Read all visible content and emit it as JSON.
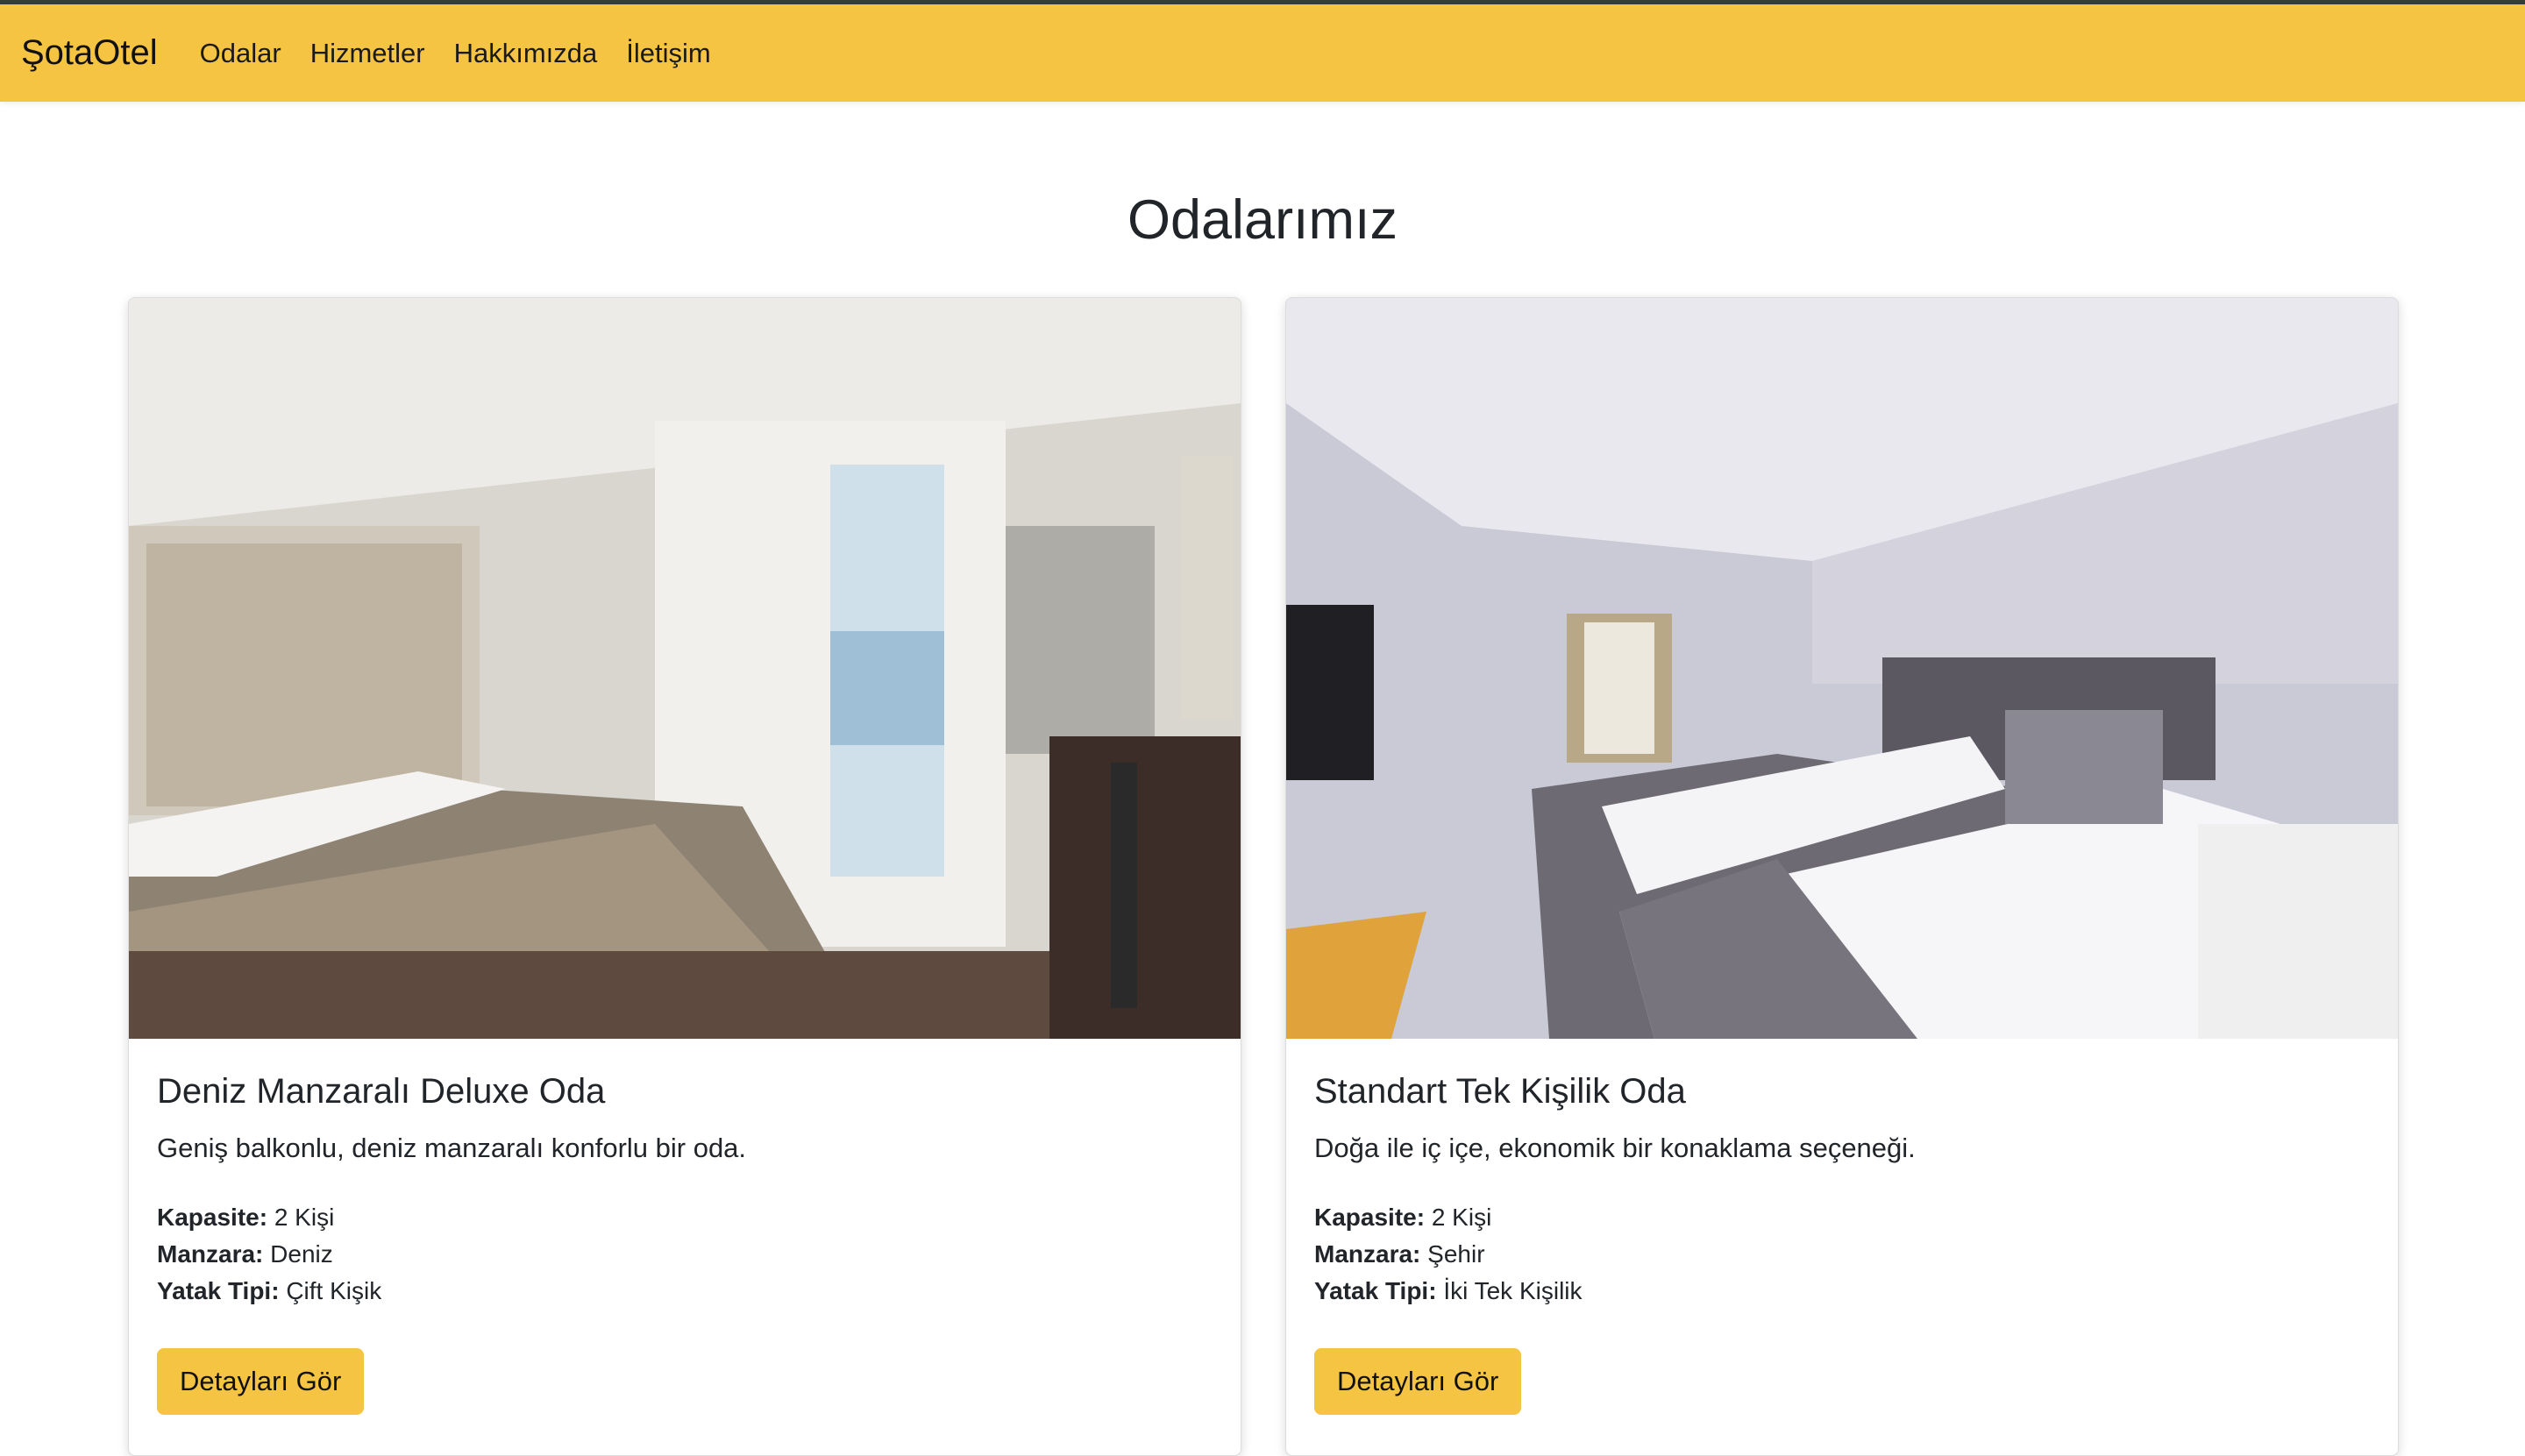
{
  "navbar": {
    "brand": "ŞotaOtel",
    "links": [
      "Odalar",
      "Hizmetler",
      "Hakkımızda",
      "İletişim"
    ]
  },
  "page_title": "Odalarımız",
  "rooms": [
    {
      "title": "Deniz Manzaralı Deluxe Oda",
      "description": "Geniş balkonlu, deniz manzaralı konforlu bir oda.",
      "capacity_label": "Kapasite:",
      "capacity": "2 Kişi",
      "view_label": "Manzara:",
      "view": "Deniz",
      "bed_label": "Yatak Tipi:",
      "bed": "Çift Kişik",
      "button": "Detayları Gör"
    },
    {
      "title": "Standart Tek Kişilik Oda",
      "description": "Doğa ile iç içe, ekonomik bir konaklama seçeneği.",
      "capacity_label": "Kapasite:",
      "capacity": "2 Kişi",
      "view_label": "Manzara:",
      "view": "Şehir",
      "bed_label": "Yatak Tipi:",
      "bed": "İki Tek Kişilik",
      "button": "Detayları Gör"
    }
  ],
  "colors": {
    "accent": "#f6c443",
    "text": "#212529"
  }
}
